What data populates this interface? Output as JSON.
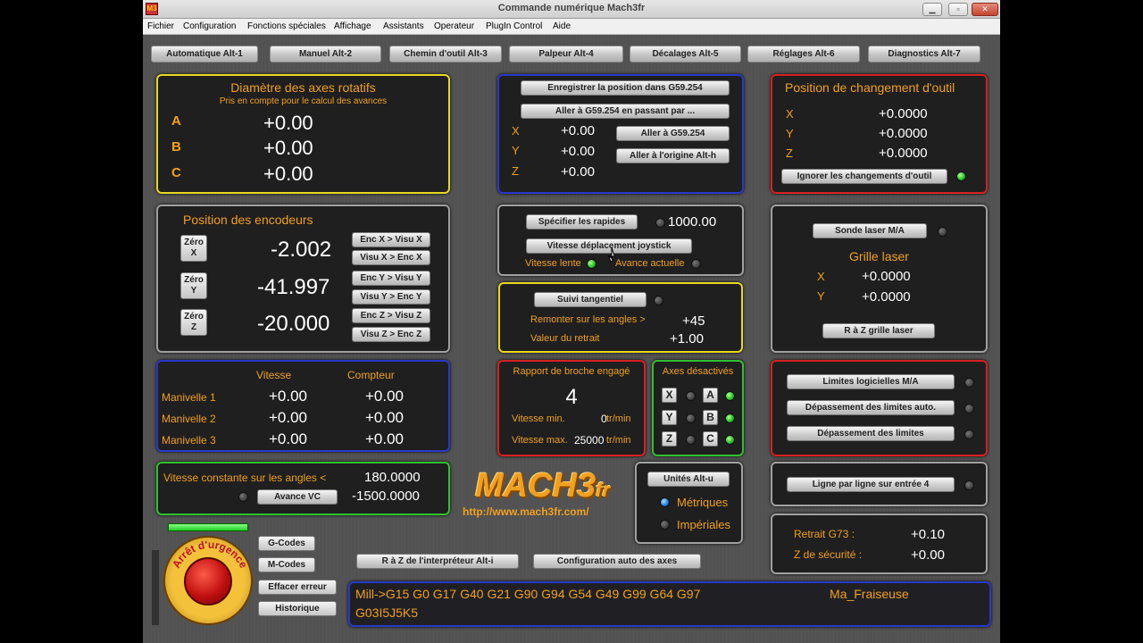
{
  "window": {
    "title": "Commande numérique Mach3fr",
    "min": "▁",
    "max": "▫",
    "close": "✕",
    "app_icon": "M3"
  },
  "menu": [
    "Fichier",
    "Configuration",
    "Fonctions spéciales",
    "Affichage",
    "Assistants",
    "Operateur",
    "PlugIn Control",
    "Aide"
  ],
  "tabs": [
    "Automatique Alt-1",
    "Manuel Alt-2",
    "Chemin d'outil Alt-3",
    "Palpeur Alt-4",
    "Décalages Alt-5",
    "Réglages Alt-6",
    "Diagnostics Alt-7"
  ],
  "rotary": {
    "title": "Diamètre des axes rotatifs",
    "subtitle": "Pris en compte pour le calcul des avances",
    "axes": [
      {
        "label": "A",
        "value": "+0.00"
      },
      {
        "label": "B",
        "value": "+0.00"
      },
      {
        "label": "C",
        "value": "+0.00"
      }
    ]
  },
  "encoders": {
    "title": "Position des encodeurs",
    "rows": [
      {
        "zero": "Zéro X",
        "value": "-2.002",
        "b1": "Enc X > Visu X",
        "b2": "Visu X > Enc X"
      },
      {
        "zero": "Zéro Y",
        "value": "-41.997",
        "b1": "Enc Y > Visu Y",
        "b2": "Visu Y > Enc Y"
      },
      {
        "zero": "Zéro Z",
        "value": "-20.000",
        "b1": "Enc Z > Visu Z",
        "b2": "Visu Z > Enc Z"
      }
    ]
  },
  "g59": {
    "save": "Enregistrer la position dans G59.254",
    "goto_via": "Aller à G59.254 en passant par ...",
    "goto": "Aller à G59.254",
    "goto_origin": "Aller à l'origine Alt-h",
    "rows": [
      {
        "label": "X",
        "value": "+0.00"
      },
      {
        "label": "Y",
        "value": "+0.00"
      },
      {
        "label": "Z",
        "value": "+0.00"
      }
    ]
  },
  "toolchange": {
    "title": "Position de changement d'outil",
    "rows": [
      {
        "label": "X",
        "value": "+0.0000"
      },
      {
        "label": "Y",
        "value": "+0.0000"
      },
      {
        "label": "Z",
        "value": "+0.0000"
      }
    ],
    "ignore": "Ignorer les changements d'outil"
  },
  "rapids": {
    "set": "Spécifier les rapides",
    "value": "1000.00",
    "joystick": "Vitesse déplacement joystick",
    "slow": "Vitesse lente",
    "current": "Avance actuelle"
  },
  "laser": {
    "toggle": "Sonde laser M/A",
    "grid": "Grille laser",
    "rows": [
      {
        "label": "X",
        "value": "+0.0000"
      },
      {
        "label": "Y",
        "value": "+0.0000"
      }
    ],
    "reset": "R à Z grille laser"
  },
  "tangent": {
    "btn": "Suivi tangentiel",
    "lift_label": "Remonter sur les angles >",
    "lift": "+45",
    "retract_label": "Valeur du retrait",
    "retract": "+1.00"
  },
  "handwheel": {
    "h_speed": "Vitesse",
    "h_count": "Compteur",
    "rows": [
      {
        "label": "Manivelle 1",
        "speed": "+0.00",
        "count": "+0.00"
      },
      {
        "label": "Manivelle 2",
        "speed": "+0.00",
        "count": "+0.00"
      },
      {
        "label": "Manivelle 3",
        "speed": "+0.00",
        "count": "+0.00"
      }
    ]
  },
  "spindle": {
    "title": "Rapport de broche engagé",
    "value": "4",
    "min_label": "Vitesse min.",
    "min": "0",
    "max_label": "Vitesse max.",
    "max": "25000",
    "unit": "tr/min"
  },
  "disabled": {
    "title": "Axes désactivés",
    "left": [
      "X",
      "Y",
      "Z"
    ],
    "right": [
      "A",
      "B",
      "C"
    ]
  },
  "limits": {
    "soft": "Limites logicielles M/A",
    "auto": "Dépassement des limites auto.",
    "over": "Dépassement des limites"
  },
  "cv": {
    "label": "Vitesse constante sur les angles <",
    "angle": "180.0000",
    "btn": "Avance VC",
    "value": "-1500.0000"
  },
  "logo": {
    "text": "MACH3",
    "suffix": "fr",
    "url": "http://www.mach3fr.com/"
  },
  "units": {
    "btn": "Unités Alt-u",
    "metric": "Métriques",
    "imperial": "Impériales"
  },
  "line": {
    "btn": "Ligne par ligne sur entrée 4"
  },
  "g73": {
    "label": "Retrait G73 :",
    "value": "+0.10",
    "safe_label": "Z de sécurité :",
    "safe": "+0.00"
  },
  "estop": {
    "label": "Arrêt d'urgence"
  },
  "side_buttons": [
    "G-Codes",
    "M-Codes",
    "Effacer erreur",
    "Historique"
  ],
  "bottom_buttons": {
    "reset": "R à Z de l'interpréteur Alt-i",
    "auto": "Configuration auto des axes"
  },
  "status": {
    "line1": "Mill->G15  G0 G17 G40 G21 G90 G94 G54 G49 G99 G64 G97",
    "line2": "G03I5J5K5",
    "profile": "Ma_Fraiseuse"
  }
}
